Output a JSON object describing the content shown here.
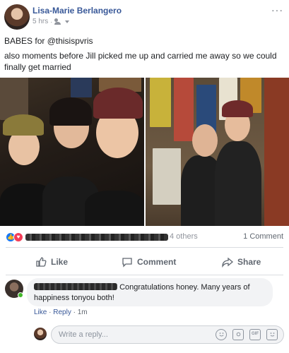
{
  "post": {
    "author": "Lisa-Marie Berlangero",
    "time": "5 hrs",
    "audience_icon": "friends-icon",
    "more_label": "···",
    "lines": [
      "BABES for @thisispvris",
      "also moments before Jill picked me up and carried me away so we could finally get married"
    ]
  },
  "reactions": {
    "icons": [
      "like-icon",
      "love-icon"
    ],
    "like_glyph": "👍",
    "love_glyph": "♥",
    "others_tail": "4 others",
    "comment_count": "1 Comment"
  },
  "actions": {
    "like": "Like",
    "comment": "Comment",
    "share": "Share"
  },
  "comment": {
    "text": "Congratulations honey. Many years of happiness tonyou both!",
    "like": "Like",
    "sep": "·",
    "reply": "Reply",
    "time": "1m"
  },
  "reply_box": {
    "placeholder": "Write a reply...",
    "icons": [
      "emoji-icon",
      "camera-icon",
      "gif-icon",
      "sticker-icon"
    ],
    "gif_label": "GIF"
  },
  "colors": {
    "link": "#385898",
    "secondary": "#90949c",
    "like": "#1877f2",
    "love": "#f33e58",
    "online": "#42b72a"
  }
}
